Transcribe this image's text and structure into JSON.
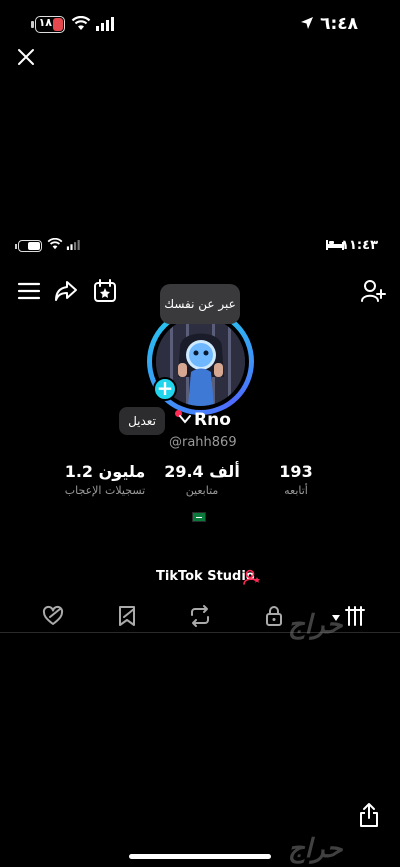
{
  "status_bar": {
    "time": "٦:٤٨",
    "battery_level": "١٨",
    "battery_color": "#e5484d"
  },
  "inner_status_bar": {
    "time": "١١:٤٣"
  },
  "profile": {
    "tooltip": "عبر عن نفسك",
    "edit_label": "تعديل",
    "name": "Rno",
    "handle": "@rahh869"
  },
  "stats": [
    {
      "value": "193",
      "label": "أتابعه"
    },
    {
      "value": "29.4 ألف",
      "label": "متابعين"
    },
    {
      "value": "1.2 مليون",
      "label": "تسجيلات الإعجاب"
    }
  ],
  "studio_label": "TikTok Studio",
  "watermark": "حراج",
  "colors": {
    "accent": "#20d5ec",
    "ring_secondary": "#4f6bff",
    "live_dot": "#fe2c55",
    "background": "#000000"
  },
  "icons": {
    "toolbar_left": [
      "menu-icon",
      "share-icon",
      "calendar-star-icon"
    ],
    "toolbar_right": "add-friend-icon",
    "tabs": [
      "grid-icon",
      "lock-icon",
      "repost-icon",
      "bookmark-icon",
      "liked-icon"
    ]
  }
}
